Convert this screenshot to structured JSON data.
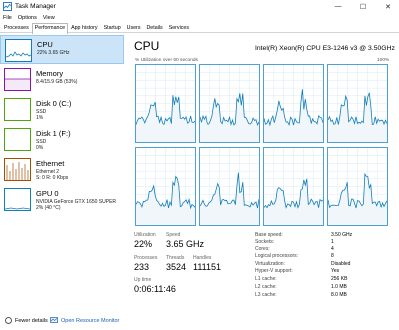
{
  "window": {
    "title": "Task Manager",
    "minimize": "—",
    "maximize": "☐",
    "close": "✕"
  },
  "menu": [
    "File",
    "Options",
    "View"
  ],
  "tabs": [
    "Processes",
    "Performance",
    "App history",
    "Startup",
    "Users",
    "Details",
    "Services"
  ],
  "active_tab": "Performance",
  "sidebar": [
    {
      "name": "CPU",
      "sub1": "22%  3.65 GHz",
      "sub2": "",
      "color": "#117dbb",
      "active": true
    },
    {
      "name": "Memory",
      "sub1": "8.4/15.9 GB (53%)",
      "sub2": "",
      "color": "#8b12ae",
      "active": false
    },
    {
      "name": "Disk 0 (C:)",
      "sub1": "SSD",
      "sub2": "1%",
      "color": "#4da60c",
      "active": false
    },
    {
      "name": "Disk 1 (F:)",
      "sub1": "SSD",
      "sub2": "0%",
      "color": "#4da60c",
      "active": false
    },
    {
      "name": "Ethernet",
      "sub1": "Ethernet 2",
      "sub2": "S: 0  R: 0 Kbps",
      "color": "#a74f01",
      "active": false
    },
    {
      "name": "GPU 0",
      "sub1": "NVIDIA GeForce GTX 1650 SUPER",
      "sub2": "2% (40 °C)",
      "color": "#117dbb",
      "active": false
    }
  ],
  "main": {
    "title": "CPU",
    "model": "Intel(R) Xeon(R) CPU E3-1246 v3 @ 3.50GHz",
    "util_label": "% Utilization over 60 seconds",
    "util_max": "100%",
    "accent": "#117dbb",
    "fill": "#f1f6fa"
  },
  "stats": {
    "utilization_label": "Utilization",
    "utilization": "22%",
    "speed_label": "Speed",
    "speed": "3.65 GHz",
    "processes_label": "Processes",
    "processes": "233",
    "threads_label": "Threads",
    "threads": "3524",
    "handles_label": "Handles",
    "handles": "111151",
    "uptime_label": "Up time",
    "uptime": "0:06:11:46"
  },
  "specs": [
    {
      "label": "Base speed:",
      "value": "3.50 GHz"
    },
    {
      "label": "Sockets:",
      "value": "1"
    },
    {
      "label": "Cores:",
      "value": "4"
    },
    {
      "label": "Logical processors:",
      "value": "8"
    },
    {
      "label": "Virtualization:",
      "value": "Disabled"
    },
    {
      "label": "Hyper-V support:",
      "value": "Yes"
    },
    {
      "label": "L1 cache:",
      "value": "256 KB"
    },
    {
      "label": "L2 cache:",
      "value": "1.0 MB"
    },
    {
      "label": "L3 cache:",
      "value": "8.0 MB"
    }
  ],
  "footer": {
    "fewer_details": "Fewer details",
    "open_monitor": "Open Resource Monitor"
  }
}
